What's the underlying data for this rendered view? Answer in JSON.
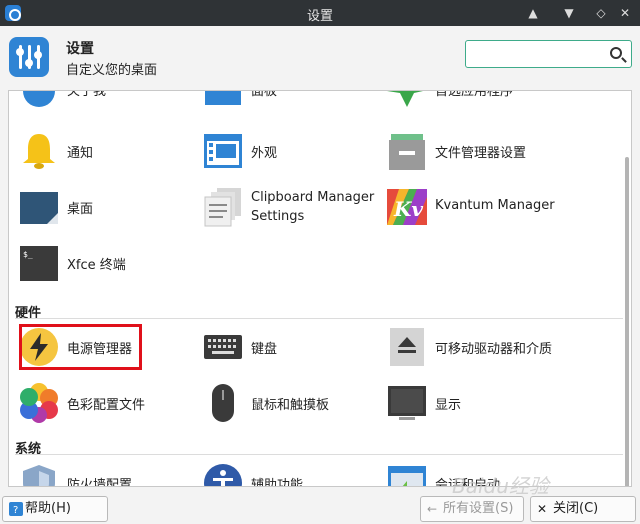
{
  "window": {
    "title": "设置"
  },
  "header": {
    "title": "设置",
    "subtitle": "自定义您的桌面"
  },
  "search": {
    "placeholder": "",
    "value": ""
  },
  "partial_row": {
    "items": [
      {
        "label": "关于我"
      },
      {
        "label": "面板"
      },
      {
        "label": "首选应用程序"
      }
    ]
  },
  "personal": {
    "items": [
      {
        "label": "通知"
      },
      {
        "label": "外观"
      },
      {
        "label": "文件管理器设置"
      },
      {
        "label": "桌面"
      },
      {
        "label": "Clipboard Manager Settings"
      },
      {
        "label": "Kvantum Manager"
      },
      {
        "label": "Xfce 终端"
      }
    ]
  },
  "hardware": {
    "title": "硬件",
    "items": [
      {
        "label": "电源管理器"
      },
      {
        "label": "键盘"
      },
      {
        "label": "可移动驱动器和介质"
      },
      {
        "label": "色彩配置文件"
      },
      {
        "label": "鼠标和触摸板"
      },
      {
        "label": "显示"
      }
    ]
  },
  "system": {
    "title": "系统",
    "items": [
      {
        "label": "防火墙配置"
      },
      {
        "label": "辅助功能"
      },
      {
        "label": "会话和启动"
      }
    ]
  },
  "footer": {
    "help": "帮助(H)",
    "all_settings": "所有设置(S)",
    "close": "关闭(C)"
  },
  "watermark": "Baidu经验",
  "colors": {
    "accent": "#2f84d4",
    "highlight": "#e0101a",
    "search_border": "#3eab8a"
  }
}
